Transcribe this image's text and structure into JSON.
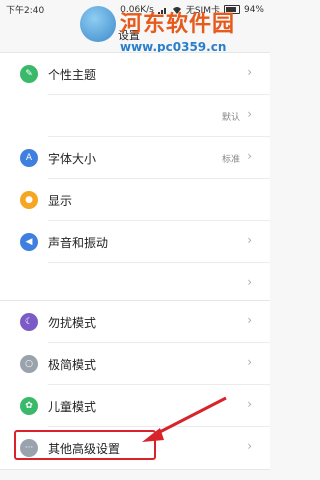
{
  "status_bar": {
    "time": "下午2:40",
    "speed": "0.06K/s",
    "sim": "无SIM卡",
    "battery": "94%"
  },
  "header": {
    "title": "设置"
  },
  "watermark": {
    "site_name": "河东软件园",
    "url": "www.pc0359.cn"
  },
  "settings": {
    "theme": {
      "label": "个性主题",
      "icon": "brush-icon",
      "color": "#3bb96a"
    },
    "wallpaper": {
      "value": "默认"
    },
    "font_size": {
      "label": "字体大小",
      "value": "标准",
      "icon": "font-icon",
      "color": "#3f7fe0"
    },
    "display": {
      "label": "显示",
      "icon": "sun-icon",
      "color": "#f5a623"
    },
    "sound": {
      "label": "声音和振动",
      "icon": "speaker-icon",
      "color": "#3f7fe0"
    },
    "dnd": {
      "label": "勿扰模式",
      "icon": "moon-icon",
      "color": "#7b5cc7"
    },
    "simple_mode": {
      "label": "极简模式",
      "icon": "simple-mode-icon",
      "color": "#9aa3ad"
    },
    "kids_mode": {
      "label": "儿童模式",
      "icon": "kids-icon",
      "color": "#3bb96a"
    },
    "advanced": {
      "label": "其他高级设置",
      "icon": "more-icon",
      "color": "#9aa3ad"
    }
  },
  "annotation": {
    "highlight_color": "#d8232a"
  }
}
